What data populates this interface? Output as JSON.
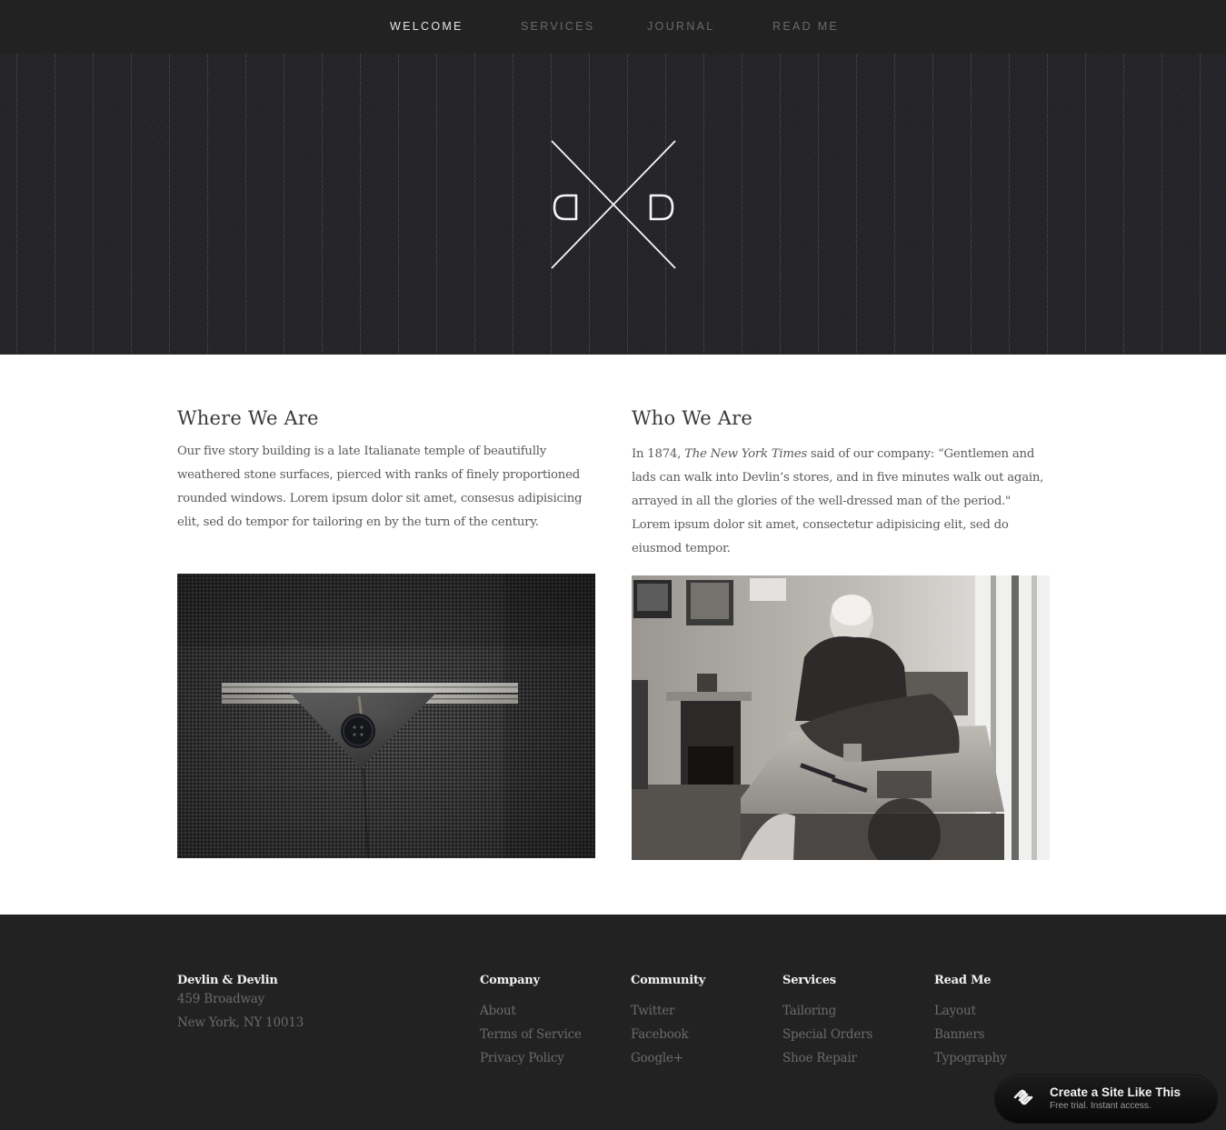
{
  "nav": {
    "items": [
      {
        "label": "WELCOME",
        "active": true
      },
      {
        "label": "SERVICES",
        "active": false
      },
      {
        "label": "JOURNAL",
        "active": false
      },
      {
        "label": "READ ME",
        "active": false
      }
    ]
  },
  "hero": {
    "logo_left_letter": "D",
    "logo_right_letter": "D",
    "logo_icon": "dxd-monogram-logo"
  },
  "sections": {
    "where": {
      "title": "Where We Are",
      "body": "Our five story building is a late Italianate temple of beautifully weathered stone surfaces, pierced with ranks of finely proportioned rounded windows. Lorem ipsum dolor sit amet, consesus adipisicing elit, sed do tempor for tailoring en by the turn of the century.",
      "image_alt": "Close-up of a grey tweed jacket pocket with a triangular flap and button"
    },
    "who": {
      "title": "Who We Are",
      "body_before": "In 1874, ",
      "body_em": "The New York Times",
      "body_after": " said of our company: “Gentlemen and lads can walk into Devlin’s stores, and in five minutes walk out again, arrayed in all the glories of the well-dressed man of the period.\" Lorem ipsum dolor sit amet, consectetur adipisicing elit, sed do eiusmod tempor.",
      "image_alt": "Black and white photo of an elderly tailor sewing cross-legged on a workbench"
    }
  },
  "footer": {
    "brand": {
      "name": "Devlin & Devlin",
      "address_line1": "459 Broadway",
      "address_line2": "New York, NY 10013"
    },
    "columns": [
      {
        "heading": "Company",
        "links": [
          "About",
          "Terms of Service",
          "Privacy Policy"
        ]
      },
      {
        "heading": "Community",
        "links": [
          "Twitter",
          "Facebook",
          "Google+"
        ]
      },
      {
        "heading": "Services",
        "links": [
          "Tailoring",
          "Special Orders",
          "Shoe Repair"
        ]
      },
      {
        "heading": "Read Me",
        "links": [
          "Layout",
          "Banners",
          "Typography"
        ]
      }
    ]
  },
  "badge": {
    "title": "Create a Site Like This",
    "subtitle": "Free trial. Instant access.",
    "icon": "squarespace-logo-icon"
  },
  "colors": {
    "nav_bg": "#222222",
    "footer_bg": "#222222",
    "nav_active": "#e6e6e6",
    "nav_inactive": "#6a6a6a",
    "heading_text": "#3a3a3a",
    "body_text": "#5a5a5a",
    "footer_link": "#6b6b6b"
  }
}
